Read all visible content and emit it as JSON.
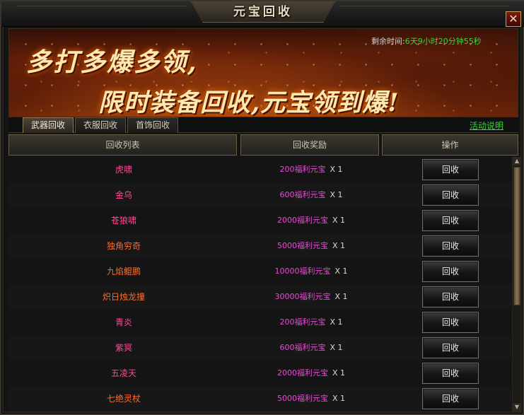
{
  "window": {
    "title": "元宝回收",
    "close_label": "✕"
  },
  "banner": {
    "line1": "多打多爆多领,",
    "line2": "限时装备回收,元宝领到爆!",
    "timer_label": "剩余时间:",
    "timer_value": "6天9小时20分钟55秒"
  },
  "tabs": [
    {
      "label": "武器回收",
      "active": true
    },
    {
      "label": "衣服回收",
      "active": false
    },
    {
      "label": "首饰回收",
      "active": false
    }
  ],
  "help_link": "活动说明",
  "headers": {
    "list": "回收列表",
    "reward": "回收奖励",
    "action": "操作"
  },
  "colors": {
    "item_pink": "#ff4a9a",
    "item_orange": "#ff6a2a",
    "reward": "#e84ad6",
    "timer": "#3cd23c"
  },
  "rows": [
    {
      "name": "虎啸",
      "reward": "200福利元宝",
      "mult": "X 1",
      "button": "回收",
      "color": "#ff4a9a"
    },
    {
      "name": "金乌",
      "reward": "600福利元宝",
      "mult": "X 1",
      "button": "回收",
      "color": "#ff4a9a"
    },
    {
      "name": "苍狼啸",
      "reward": "2000福利元宝",
      "mult": "X 1",
      "button": "回收",
      "color": "#ff4a9a"
    },
    {
      "name": "独角穷奇",
      "reward": "5000福利元宝",
      "mult": "X 1",
      "button": "回收",
      "color": "#ff6a2a"
    },
    {
      "name": "九焰鲲鹏",
      "reward": "10000福利元宝",
      "mult": "X 1",
      "button": "回收",
      "color": "#ff6a2a"
    },
    {
      "name": "炽日烛龙撞",
      "reward": "30000福利元宝",
      "mult": "X 1",
      "button": "回收",
      "color": "#ff6a2a"
    },
    {
      "name": "青炎",
      "reward": "200福利元宝",
      "mult": "X 1",
      "button": "回收",
      "color": "#ff4a9a"
    },
    {
      "name": "紫冥",
      "reward": "600福利元宝",
      "mult": "X 1",
      "button": "回收",
      "color": "#ff4a9a"
    },
    {
      "name": "五凌天",
      "reward": "2000福利元宝",
      "mult": "X 1",
      "button": "回收",
      "color": "#ff4a9a"
    },
    {
      "name": "七绝灵杖",
      "reward": "5000福利元宝",
      "mult": "X 1",
      "button": "回收",
      "color": "#ff6a2a"
    }
  ]
}
